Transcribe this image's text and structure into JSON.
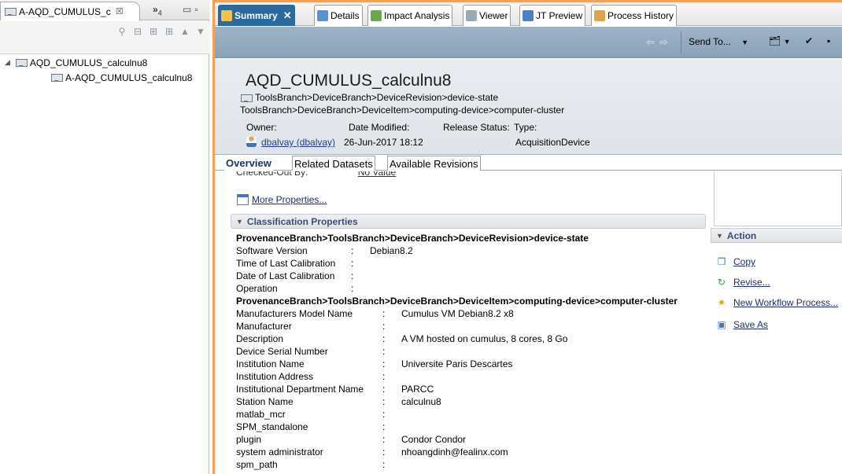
{
  "left_panel": {
    "tab_label": "A-AQD_CUMULUS_c",
    "tab_close": "☒",
    "overflow_label": "»",
    "overflow_count": "4",
    "tree": [
      {
        "label": "AQD_CUMULUS_calculnu8"
      },
      {
        "label": "A-AQD_CUMULUS_calculnu8"
      }
    ]
  },
  "editor_tabs": [
    {
      "label": "Summary",
      "icon": "summary-icon",
      "active": true
    },
    {
      "label": "Details",
      "icon": "details-icon"
    },
    {
      "label": "Impact Analysis",
      "icon": "impact-icon"
    },
    {
      "label": "Viewer",
      "icon": "viewer-icon"
    },
    {
      "label": "JT Preview",
      "icon": "jt-icon"
    },
    {
      "label": "Process History",
      "icon": "history-icon"
    }
  ],
  "toolbar": {
    "send_to": "Send To..."
  },
  "header": {
    "title": "AQD_CUMULUS_calculnu8",
    "path1": "ToolsBranch>DeviceBranch>DeviceRevision>device-state",
    "path2": "ToolsBranch>DeviceBranch>DeviceItem>computing-device>computer-cluster",
    "owner_label": "Owner:",
    "date_label": "Date Modified:",
    "release_label": "Release Status:",
    "type_label": "Type:",
    "owner_value": "dbalvay (dbalvay)",
    "date_value": "26-Jun-2017 18:12",
    "type_value": "AcquisitionDevice"
  },
  "subtabs": [
    {
      "label": "Overview"
    },
    {
      "label": "Related Datasets"
    },
    {
      "label": "Available Revisions"
    }
  ],
  "overview": {
    "checked_out_label": "Checked-Out By:",
    "checked_out_value": "No Value",
    "more_properties": "More Properties...",
    "classification_title": "Classification Properties",
    "path_a": "ProvenanceBranch>ToolsBranch>DeviceBranch>DeviceRevision>device-state",
    "props_a": [
      {
        "name": "Software Version",
        "value": "Debian8.2"
      },
      {
        "name": "Time of Last Calibration",
        "value": ""
      },
      {
        "name": "Date of Last Calibration",
        "value": ""
      },
      {
        "name": "Operation",
        "value": ""
      }
    ],
    "path_b": "ProvenanceBranch>ToolsBranch>DeviceBranch>DeviceItem>computing-device>computer-cluster",
    "props_b": [
      {
        "name": "Manufacturers Model Name",
        "value": "Cumulus VM Debian8.2 x8"
      },
      {
        "name": "Manufacturer",
        "value": ""
      },
      {
        "name": "Description",
        "value": "A VM hosted on cumulus, 8 cores, 8 Go"
      },
      {
        "name": "Device Serial Number",
        "value": ""
      },
      {
        "name": "Institution Name",
        "value": "Universite Paris Descartes"
      },
      {
        "name": "Institution Address",
        "value": ""
      },
      {
        "name": "Institutional Department Name",
        "value": "PARCC"
      },
      {
        "name": "Station Name",
        "value": "calculnu8"
      },
      {
        "name": "matlab_mcr",
        "value": ""
      },
      {
        "name": "SPM_standalone",
        "value": ""
      },
      {
        "name": "plugin",
        "value": "Condor Condor"
      },
      {
        "name": "system administrator",
        "value": "nhoangdinh@fealinx.com"
      },
      {
        "name": "spm_path",
        "value": ""
      }
    ]
  },
  "action": {
    "title": "Action",
    "items": [
      {
        "label": "Copy"
      },
      {
        "label": "Revise..."
      },
      {
        "label": "New Workflow Process..."
      },
      {
        "label": "Save As"
      }
    ]
  }
}
